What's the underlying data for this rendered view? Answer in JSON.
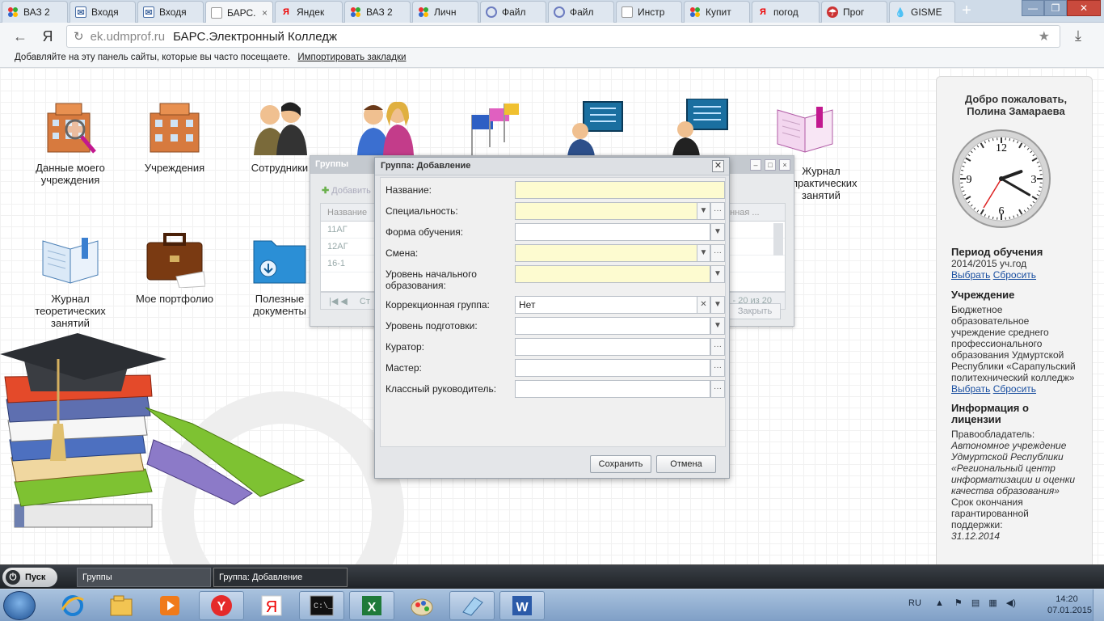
{
  "browser": {
    "tabs": [
      {
        "label": "ВАЗ 2",
        "icon": "multi-dot-icon"
      },
      {
        "label": "Входя",
        "icon": "mail-icon"
      },
      {
        "label": "Входя",
        "icon": "mail-icon"
      },
      {
        "label": "БАРС.",
        "icon": "page-icon",
        "active": true,
        "close": "×"
      },
      {
        "label": "Яндек",
        "icon": "yandex-icon"
      },
      {
        "label": "ВАЗ 2",
        "icon": "multi-dot-icon"
      },
      {
        "label": "Личн",
        "icon": "multi-dot-icon"
      },
      {
        "label": "Файл",
        "icon": "disk-icon"
      },
      {
        "label": "Файл",
        "icon": "disk-icon"
      },
      {
        "label": "Инстр",
        "icon": "page-icon"
      },
      {
        "label": "Купит",
        "icon": "multi-dot-icon"
      },
      {
        "label": "погод",
        "icon": "yandex-icon"
      },
      {
        "label": "Прог",
        "icon": "weather-icon"
      },
      {
        "label": "GISME",
        "icon": "drop-icon"
      }
    ],
    "new_tab": "+",
    "window_controls": {
      "minimize": "—",
      "restore": "❐",
      "close": "✕"
    },
    "nav": {
      "back": "←",
      "yandex_logo": "Я",
      "reload": "↻",
      "download": "⤓",
      "star": "★"
    },
    "address": {
      "domain": "ek.udmprof.ru",
      "page_name": "БАРС.Электронный Колледж"
    },
    "bookmarks_bar": {
      "text": "Добавляйте на эту панель сайты, которые вы часто посещаете.",
      "link": "Импортировать закладки"
    }
  },
  "desktop_icons": [
    {
      "label": "Данные моего учреждения",
      "icon": "building-search-icon"
    },
    {
      "label": "Учреждения",
      "icon": "building-icon"
    },
    {
      "label": "Сотрудники",
      "icon": "employees-icon"
    },
    {
      "label": "",
      "icon": "users-icon"
    },
    {
      "label": "",
      "icon": "flags-icon"
    },
    {
      "label": "",
      "icon": "computer-user-icon"
    },
    {
      "label": "",
      "icon": "monitor-user-icon"
    },
    {
      "label": "Журнал практических занятий",
      "icon": "book-pink-icon"
    },
    {
      "label": "Журнал теоретических занятий",
      "icon": "book-blue-icon"
    },
    {
      "label": "Мое портфолио",
      "icon": "briefcase-icon"
    },
    {
      "label": "Полезные документы",
      "icon": "folder-download-icon"
    }
  ],
  "sidebar": {
    "welcome_line1": "Добро пожаловать,",
    "welcome_line2": "Полина Замараева",
    "clock": {
      "hour": 2,
      "minute": 20
    },
    "period_title": "Период обучения",
    "period_value": "2014/2015 уч.год",
    "select_link": "Выбрать",
    "reset_link": "Сбросить",
    "institution_title": "Учреждение",
    "institution_text": "Бюджетное образовательное учреждение среднего профессионального образования Удмуртской Республики «Сарапульский политехнический колледж»",
    "license_title": "Информация о лицензии",
    "holder_label": "Правообладатель:",
    "holder_value": "Автономное учреждение Удмуртской Республики «Региональный центр информатизации и оценки качества образования»",
    "support_label": "Срок окончания гарантированной поддержки:",
    "support_value": "31.12.2014"
  },
  "groups_window": {
    "title": "Группы",
    "add_button": "Добавить",
    "column_name": "Название",
    "column_right": "онная ...",
    "rows": [
      "11АГ",
      "12АГ",
      "16-1"
    ],
    "pager_left": "Ст",
    "pager_info": "и 1 - 20 из 20",
    "close_button": "Закрыть"
  },
  "dialog": {
    "title": "Группа: Добавление",
    "fields": {
      "name": {
        "label": "Название:",
        "value": ""
      },
      "specialty": {
        "label": "Специальность:",
        "value": ""
      },
      "study_form": {
        "label": "Форма обучения:",
        "value": ""
      },
      "shift": {
        "label": "Смена:",
        "value": ""
      },
      "edu_level": {
        "label": "Уровень начального образования:",
        "value": ""
      },
      "correction": {
        "label": "Коррекционная группа:",
        "value": "Нет"
      },
      "training_level": {
        "label": "Уровень подготовки:",
        "value": ""
      },
      "curator": {
        "label": "Куратор:",
        "value": ""
      },
      "master": {
        "label": "Мастер:",
        "value": ""
      },
      "class_teacher": {
        "label": "Классный руководитель:",
        "value": ""
      }
    },
    "save_button": "Сохранить",
    "cancel_button": "Отмена"
  },
  "app_taskbar": {
    "start": "Пуск",
    "items": [
      "Группы",
      "Группа: Добавление"
    ]
  },
  "windows_taskbar": {
    "apps": [
      "ie-icon",
      "explorer-icon",
      "media-player-icon",
      "yandex-browser-icon",
      "yandex-icon",
      "cmd-icon",
      "excel-icon",
      "paint-icon",
      "notepad-icon",
      "word-icon"
    ],
    "lang": "RU",
    "time": "14:20",
    "date": "07.01.2015"
  },
  "colors": {
    "required_field": "#fdfbd0",
    "link": "#1a4fa0",
    "taskbar": "#8fadd0"
  }
}
